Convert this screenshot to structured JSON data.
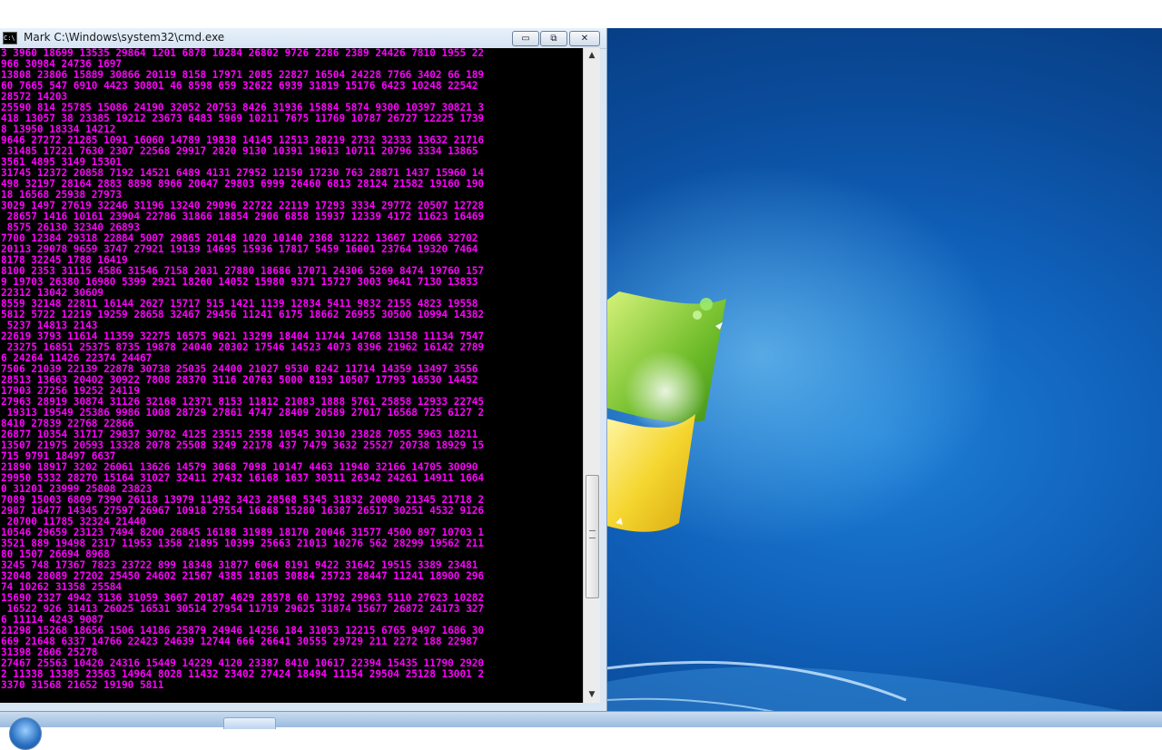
{
  "window": {
    "title": "Mark C:\\Windows\\system32\\cmd.exe",
    "icon_text": "C:\\",
    "controls": {
      "minimize": "▭",
      "restore": "⧉",
      "close": "✕"
    }
  },
  "console": {
    "text_color": "#ff00ff",
    "background": "#000000",
    "lines": [
      "3 3960 18699 13535 29864 1201 6878 10284 26802 9726 2286 2389 24426 7810 1955 22",
      "966 30984 24736 1697",
      "13808 23806 15889 30866 20119 8158 17971 2085 22827 16504 24228 7766 3402 66 189",
      "60 7665 547 6910 4423 30801 46 8598 659 32622 6939 31819 15176 6423 10248 22542",
      "28572 14203",
      "25590 814 25785 15086 24190 32052 20753 8426 31936 15884 5874 9300 10397 30821 3",
      "418 13057 38 23385 19212 23673 6483 5969 10211 7675 11769 10787 26727 12225 1739",
      "8 13950 18334 14212",
      "9646 27272 21285 1091 16060 14789 19838 14145 12513 28219 2732 32333 13632 21716",
      " 31485 17221 7630 2307 22568 29917 2820 9130 10391 19613 10711 20796 3334 13865",
      "3561 4895 3149 15301",
      "31745 12372 20858 7192 14521 6489 4131 27952 12150 17230 763 28871 1437 15960 14",
      "498 32197 28164 2883 8898 8966 20647 29803 6999 26460 6813 28124 21582 19160 190",
      "18 16568 25938 27973",
      "3029 1497 27619 32246 31196 13240 29096 22722 22119 17293 3334 29772 20507 12728",
      " 28657 1416 10161 23904 22786 31866 18854 2906 6858 15937 12339 4172 11623 16469",
      " 8575 26130 32340 26893",
      "7700 12384 29318 22884 5007 29865 20148 1020 10140 2368 31222 13667 12066 32702",
      "20113 29078 9659 3747 27921 19139 14695 15936 17817 5459 16001 23764 19320 7464",
      "8178 32245 1788 16419",
      "8100 2353 31115 4586 31546 7158 2031 27880 18686 17071 24306 5269 8474 19760 157",
      "9 19703 26380 16980 5399 2921 18260 14052 15980 9371 15727 3003 9641 7130 13833",
      "22312 13042 30609",
      "8559 32148 22811 16144 2627 15717 515 1421 1139 12834 5411 9832 2155 4823 19558",
      "5812 5722 12219 19259 28658 32467 29456 11241 6175 18662 26955 30500 10994 14382",
      " 5237 14813 2143",
      "22619 3793 11614 11359 32275 16575 9621 13299 18404 11744 14768 13158 11134 7547",
      " 23275 16851 25375 8735 19878 24040 20302 17546 14523 4073 8396 21962 16142 2789",
      "6 24264 11426 22374 24467",
      "7506 21039 22139 22878 30738 25035 24400 21027 9530 8242 11714 14359 13497 3556",
      "28513 13663 20402 30922 7808 28370 3116 20763 5000 8193 10507 17793 16530 14452",
      "17903 27256 19252 24119",
      "27963 28919 30874 31126 32168 12371 8153 11812 21083 1888 5761 25858 12933 22745",
      " 19313 19549 25386 9986 1008 28729 27861 4747 28409 20589 27017 16568 725 6127 2",
      "8410 27839 22768 22866",
      "26877 10354 31717 29837 30782 4125 23515 2558 10545 30130 23828 7055 5963 18211",
      "13507 21975 20593 13328 2078 25508 3249 22178 437 7479 3632 25527 20738 18929 15",
      "715 9791 18497 6637",
      "21890 18917 3202 26061 13626 14579 3068 7098 10147 4463 11940 32166 14705 30090",
      "29950 5332 28270 15164 31027 32411 27432 16168 1637 30311 26342 24261 14911 1664",
      "0 31201 23999 25808 23823",
      "7089 15003 6809 7390 26118 13979 11492 3423 28568 5345 31832 20080 21345 21718 2",
      "2987 16477 14345 27597 26967 10918 27554 16868 15280 16387 26517 30251 4532 9126",
      " 20700 11785 32324 21440",
      "10546 29659 23123 7494 8200 26845 16188 31989 18170 20046 31577 4500 897 10703 1",
      "3521 889 19498 2317 11953 1358 21895 10399 25663 21013 10276 562 28299 19562 211",
      "80 1507 26694 8968",
      "3245 748 17367 7823 23722 899 18348 31877 6064 8191 9422 31642 19515 3389 23481",
      "32048 28089 27202 25450 24602 21567 4385 18105 30884 25723 28447 11241 18900 296",
      "74 10262 31358 25584",
      "15690 2327 4942 3136 31059 3667 20187 4629 28578 60 13792 29963 5110 27623 10282",
      " 16522 926 31413 26025 16531 30514 27954 11719 29625 31874 15677 26872 24173 327",
      "6 11114 4243 9087",
      "21298 15268 18656 1506 14186 25879 24946 14256 184 31053 12215 6765 9497 1686 30",
      "669 21648 6337 14766 22423 24639 12744 666 26641 30555 29729 211 2272 188 22987",
      "31398 2606 25278",
      "27467 25563 10420 24316 15449 14229 4120 23387 8410 10617 22394 15435 11790 2920",
      "2 11338 13385 23563 14964 8028 11432 23402 27424 18494 11154 29504 25128 13001 2",
      "3370 31568 21652 19190 5811"
    ]
  },
  "scrollbar": {
    "up": "▲",
    "down": "▼",
    "position_fraction": 0.82
  },
  "colors": {
    "wallpaper": "#0f5fb8",
    "window_frame": "#d9e6f4"
  }
}
